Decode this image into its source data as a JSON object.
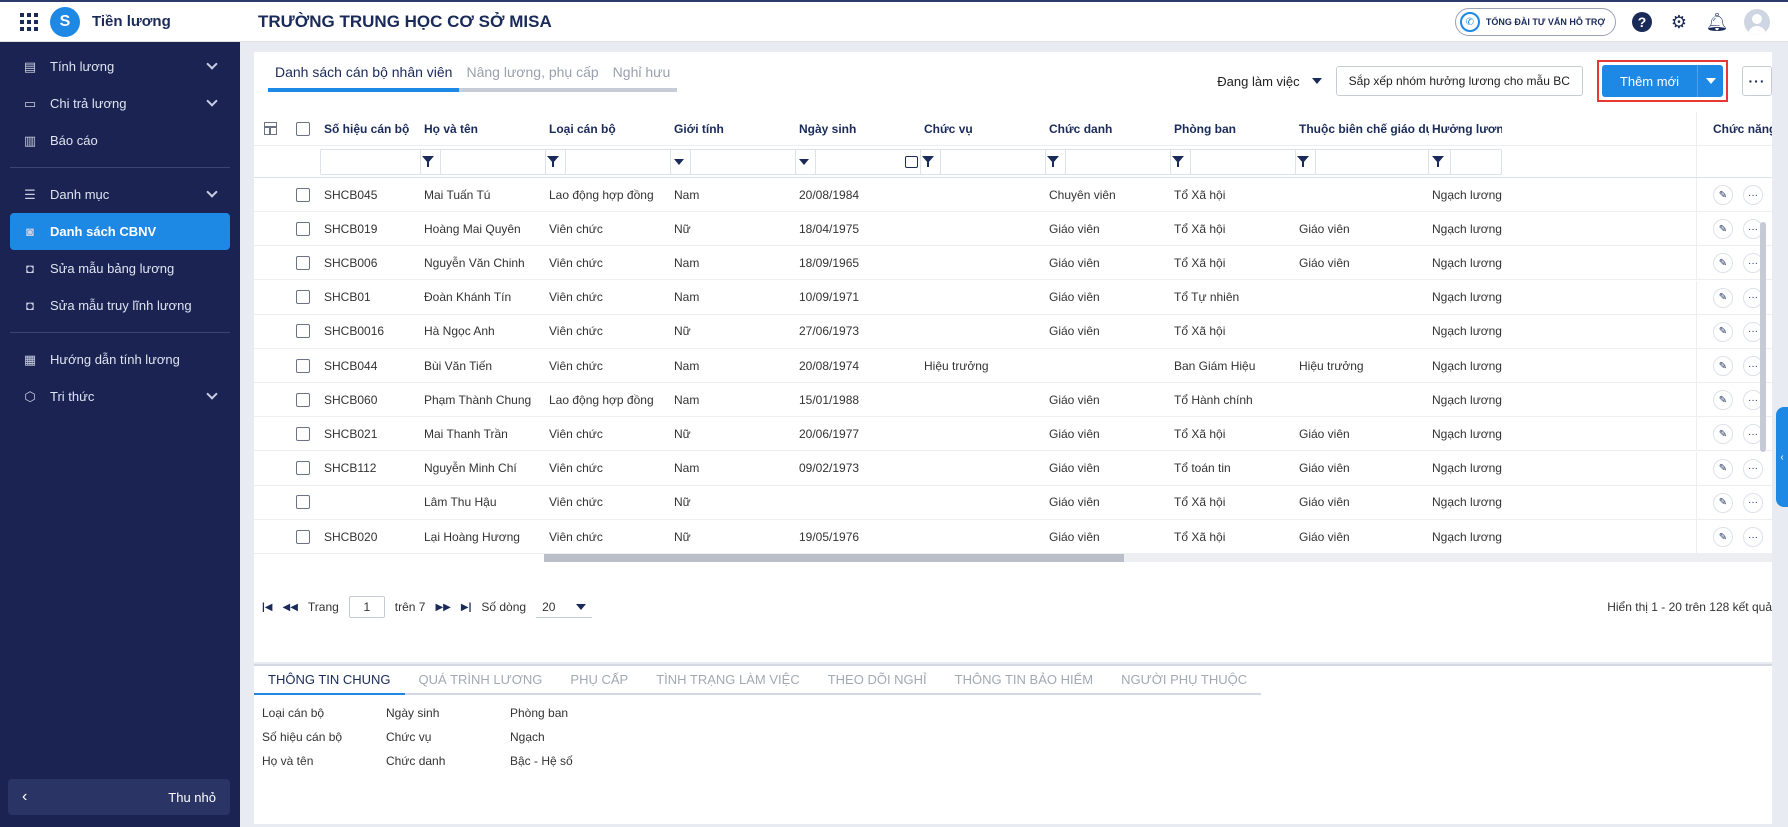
{
  "app": {
    "name": "Tiền lương",
    "logo_letter": "S",
    "school_title": "TRƯỜNG TRUNG HỌC CƠ SỞ MISA",
    "hotline_label": "TỔNG ĐÀI TƯ VẤN HỖ TRỢ"
  },
  "sidebar": {
    "items": [
      {
        "label": "Tính lương",
        "icon": "calculator-icon",
        "glyph": "▤",
        "chevron": true
      },
      {
        "label": "Chi trả lương",
        "icon": "card-icon",
        "glyph": "▭",
        "chevron": true
      },
      {
        "label": "Báo cáo",
        "icon": "chart-icon",
        "glyph": "▥",
        "chevron": false
      },
      {
        "label": "Danh mục",
        "icon": "list-icon",
        "glyph": "☰",
        "chevron": true
      },
      {
        "label": "Danh sách CBNV",
        "icon": "person-icon",
        "glyph": "◙",
        "chevron": false,
        "active": true
      },
      {
        "label": "Sửa mẫu bảng lương",
        "icon": "document-icon",
        "glyph": "◘",
        "chevron": false
      },
      {
        "label": "Sửa mẫu truy lĩnh lương",
        "icon": "document-icon",
        "glyph": "◘",
        "chevron": false
      },
      {
        "label": "Hướng dẫn tính lương",
        "icon": "book-icon",
        "glyph": "▦",
        "chevron": false
      },
      {
        "label": "Tri thức",
        "icon": "cube-icon",
        "glyph": "⬡",
        "chevron": true
      }
    ],
    "collapse_label": "Thu nhỏ"
  },
  "tabs": [
    {
      "label": "Danh sách cán bộ nhân viên",
      "active": true
    },
    {
      "label": "Nâng lương, phụ cấp",
      "active": false
    },
    {
      "label": "Nghỉ hưu",
      "active": false
    }
  ],
  "toolbar": {
    "status_filter": "Đang làm việc",
    "sort_button": "Sắp xếp nhóm hưởng lương cho mẫu BC",
    "add_button": "Thêm mới",
    "more_button": "···"
  },
  "columns": [
    "Số hiệu cán bộ",
    "Họ và tên",
    "Loại cán bộ",
    "Giới tính",
    "Ngày sinh",
    "Chức vụ",
    "Chức danh",
    "Phòng ban",
    "Thuộc biên chế giáo dục",
    "Hưởng lương t",
    "Chức năng"
  ],
  "rows": [
    [
      "SHCB045",
      "Mai Tuấn Tú",
      "Lao động hợp đồng",
      "Nam",
      "20/08/1984",
      "",
      "Chuyên viên",
      "Tổ Xã hội",
      "",
      "Ngạch lương t"
    ],
    [
      "SHCB019",
      "Hoàng Mai Quyên",
      "Viên chức",
      "Nữ",
      "18/04/1975",
      "",
      "Giáo viên",
      "Tổ Xã hội",
      "Giáo viên",
      "Ngạch lương t"
    ],
    [
      "SHCB006",
      "Nguyễn Văn Chinh",
      "Viên chức",
      "Nam",
      "18/09/1965",
      "",
      "Giáo viên",
      "Tổ Xã hội",
      "Giáo viên",
      "Ngạch lương t"
    ],
    [
      "SHCB01",
      "Đoàn Khánh Tín",
      "Viên chức",
      "Nam",
      "10/09/1971",
      "",
      "Giáo viên",
      "Tổ Tự nhiên",
      "",
      "Ngạch lương t"
    ],
    [
      "SHCB0016",
      "Hà Ngọc Anh",
      "Viên chức",
      "Nữ",
      "27/06/1973",
      "",
      "Giáo viên",
      "Tổ Xã hội",
      "",
      "Ngạch lương t"
    ],
    [
      "SHCB044",
      "Bùi Văn Tiến",
      "Viên chức",
      "Nam",
      "20/08/1974",
      "Hiệu trưởng",
      "",
      "Ban Giám Hiệu",
      "Hiệu trưởng",
      "Ngạch lương t"
    ],
    [
      "SHCB060",
      "Phạm Thành Chung",
      "Lao động hợp đồng",
      "Nam",
      "15/01/1988",
      "",
      "Giáo viên",
      "Tổ Hành chính",
      "",
      "Ngạch lương t"
    ],
    [
      "SHCB021",
      "Mai Thanh Trần",
      "Viên chức",
      "Nữ",
      "20/06/1977",
      "",
      "Giáo viên",
      "Tổ Xã hội",
      "Giáo viên",
      "Ngạch lương t"
    ],
    [
      "SHCB112",
      "Nguyễn Minh Chí",
      "Viên chức",
      "Nam",
      "09/02/1973",
      "",
      "Giáo viên",
      "Tổ toán tin",
      "Giáo viên",
      "Ngạch lương t"
    ],
    [
      "",
      "Lâm Thu Hậu",
      "Viên chức",
      "Nữ",
      "",
      "",
      "Giáo viên",
      "Tổ Xã hội",
      "Giáo viên",
      "Ngạch lương t"
    ],
    [
      "SHCB020",
      "Lại Hoàng Hương",
      "Viên chức",
      "Nữ",
      "19/05/1976",
      "",
      "Giáo viên",
      "Tổ Xã hội",
      "Giáo viên",
      "Ngạch lương t"
    ]
  ],
  "pager": {
    "page_label": "Trang",
    "page_value": "1",
    "of_label": "trên 7",
    "rows_label": "Số dòng",
    "rows_value": "20",
    "summary": "Hiển thị 1 - 20 trên 128 kết quả"
  },
  "bottom_tabs": [
    {
      "label": "THÔNG TIN CHUNG",
      "active": true
    },
    {
      "label": "QUÁ TRÌNH LƯƠNG",
      "active": false
    },
    {
      "label": "PHỤ CẤP",
      "active": false
    },
    {
      "label": "TÌNH TRẠNG LÀM VIỆC",
      "active": false
    },
    {
      "label": "THEO DÕI NGHỈ",
      "active": false
    },
    {
      "label": "THÔNG TIN BẢO HIỂM",
      "active": false
    },
    {
      "label": "NGƯỜI PHỤ THUỘC",
      "active": false
    }
  ],
  "info_fields": [
    [
      "Loại cán bộ",
      "Số hiệu cán bộ",
      "Họ và tên"
    ],
    [
      "Ngày sinh",
      "Chức vụ",
      "Chức danh"
    ],
    [
      "Phòng ban",
      "Ngạch",
      "Bậc - Hệ số"
    ]
  ],
  "colors": {
    "primary": "#1e88e5",
    "sidebar": "#1a2352",
    "highlight": "#e53935"
  }
}
